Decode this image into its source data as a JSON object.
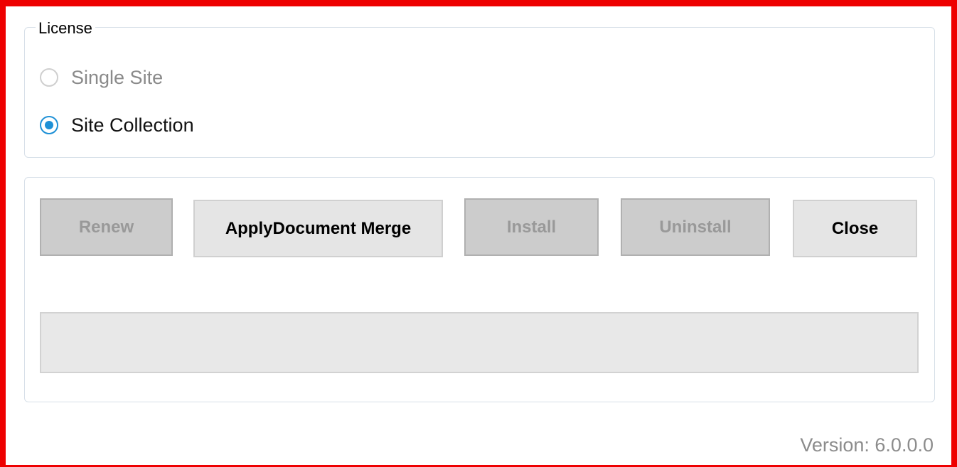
{
  "license": {
    "legend": "License",
    "options": [
      {
        "label": "Single Site",
        "selected": false,
        "enabled": false
      },
      {
        "label": "Site Collection",
        "selected": true,
        "enabled": true
      }
    ]
  },
  "actions": {
    "renew_label": "Renew",
    "apply_label": "ApplyDocument Merge",
    "install_label": "Install",
    "uninstall_label": "Uninstall",
    "close_label": "Close"
  },
  "status": {
    "text": ""
  },
  "footer": {
    "version_text": "Version: 6.0.0.0"
  },
  "colors": {
    "highlight_border": "#ee0000",
    "radio_accent": "#1e90d6",
    "disabled_button_bg": "#cccccc",
    "enabled_button_bg": "#e5e5e5"
  }
}
